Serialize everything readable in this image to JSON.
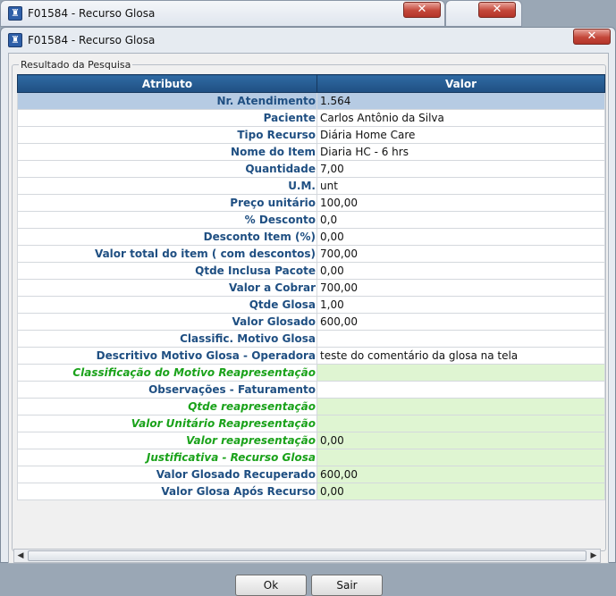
{
  "background_windows": [
    {
      "title": "F01584 - Recurso Glosa"
    },
    {
      "title": ""
    }
  ],
  "window": {
    "title": "F01584 - Recurso Glosa",
    "close_glyph": "✕"
  },
  "group": {
    "legend": "Resultado da Pesquisa"
  },
  "grid": {
    "headers": [
      "Atributo",
      "Valor"
    ],
    "rows": [
      {
        "attr": "Nr. Atendimento",
        "value": "1.564"
      },
      {
        "attr": "Paciente",
        "value": "Carlos Antônio da Silva"
      },
      {
        "attr": "Tipo Recurso",
        "value": "Diária Home Care"
      },
      {
        "attr": "Nome do Item",
        "value": "Diaria HC - 6 hrs"
      },
      {
        "attr": "Quantidade",
        "value": "7,00"
      },
      {
        "attr": "U.M.",
        "value": "unt"
      },
      {
        "attr": "Preço unitário",
        "value": "100,00"
      },
      {
        "attr": "% Desconto",
        "value": "0,0"
      },
      {
        "attr": "Desconto Item (%)",
        "value": "0,00"
      },
      {
        "attr": "Valor total do item ( com descontos)",
        "value": "700,00"
      },
      {
        "attr": "Qtde Inclusa Pacote",
        "value": "0,00"
      },
      {
        "attr": "Valor a Cobrar",
        "value": "700,00"
      },
      {
        "attr": "Qtde Glosa",
        "value": "1,00"
      },
      {
        "attr": "Valor Glosado",
        "value": "600,00"
      },
      {
        "attr": "Classific. Motivo Glosa",
        "value": ""
      },
      {
        "attr": "Descritivo Motivo Glosa - Operadora",
        "value": "teste do comentário da glosa na tela"
      },
      {
        "attr": "Classificação do Motivo Reapresentação",
        "value": ""
      },
      {
        "attr": "Observações - Faturamento",
        "value": ""
      },
      {
        "attr": "Qtde reapresentação",
        "value": ""
      },
      {
        "attr": "Valor Unitário Reapresentação",
        "value": ""
      },
      {
        "attr": "Valor reapresentação",
        "value": "0,00"
      },
      {
        "attr": "Justificativa - Recurso Glosa",
        "value": ""
      },
      {
        "attr": "Valor Glosado Recuperado",
        "value": "600,00"
      },
      {
        "attr": "Valor Glosa Após Recurso",
        "value": "0,00"
      }
    ]
  },
  "buttons": {
    "ok": "Ok",
    "exit": "Sair"
  },
  "colors": {
    "header": "#1f4f82",
    "attr_text": "#1f4f82",
    "editable_attr_text": "#1aa21a",
    "editable_bg": "#dff5d2",
    "selected_row": "#b6cbe3"
  },
  "icons": {
    "app": "app-icon",
    "close": "close-icon",
    "scroll_left": "scroll-left-arrow-icon",
    "scroll_right": "scroll-right-arrow-icon"
  }
}
